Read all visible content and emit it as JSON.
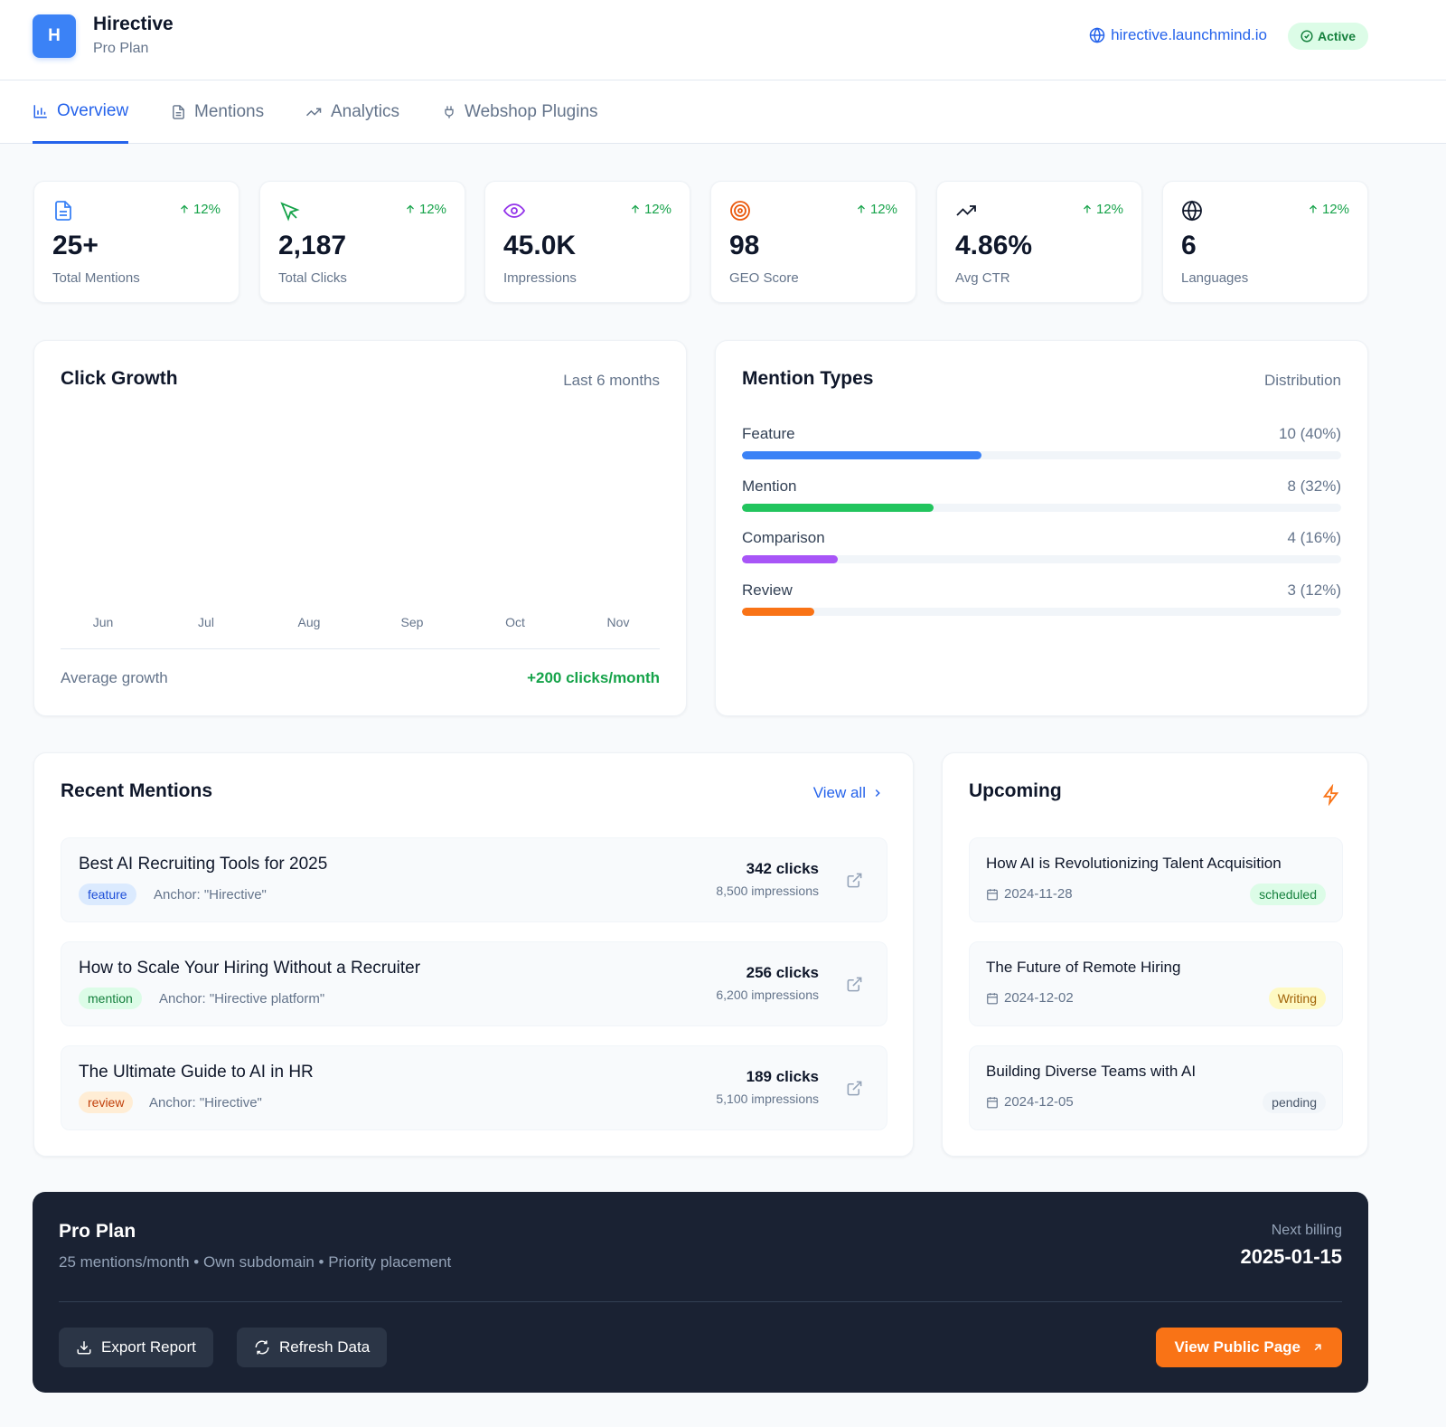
{
  "header": {
    "logo_letter": "H",
    "brand_name": "Hirective",
    "plan": "Pro Plan",
    "domain": "hirective.launchmind.io",
    "status": "Active"
  },
  "tabs": [
    {
      "label": "Overview",
      "icon": "bar-chart-icon",
      "active": true
    },
    {
      "label": "Mentions",
      "icon": "document-icon",
      "active": false
    },
    {
      "label": "Analytics",
      "icon": "trending-up-icon",
      "active": false
    },
    {
      "label": "Webshop Plugins",
      "icon": "plug-icon",
      "active": false
    }
  ],
  "stats": [
    {
      "value": "25+",
      "label": "Total Mentions",
      "trend": "12%",
      "icon": "document-icon",
      "color": "#3b82f6"
    },
    {
      "value": "2,187",
      "label": "Total Clicks",
      "trend": "12%",
      "icon": "cursor-icon",
      "color": "#16a34a"
    },
    {
      "value": "45.0K",
      "label": "Impressions",
      "trend": "12%",
      "icon": "eye-icon",
      "color": "#9333ea"
    },
    {
      "value": "98",
      "label": "GEO Score",
      "trend": "12%",
      "icon": "target-icon",
      "color": "#ea580c"
    },
    {
      "value": "4.86%",
      "label": "Avg CTR",
      "trend": "12%",
      "icon": "trending-up-icon",
      "color": "#0f172a"
    },
    {
      "value": "6",
      "label": "Languages",
      "trend": "12%",
      "icon": "globe-icon",
      "color": "#0f172a"
    }
  ],
  "click_growth": {
    "title": "Click Growth",
    "subtitle": "Last 6 months",
    "months": [
      "Jun",
      "Jul",
      "Aug",
      "Sep",
      "Oct",
      "Nov"
    ],
    "avg_label": "Average growth",
    "avg_value": "+200 clicks/month"
  },
  "mention_types": {
    "title": "Mention Types",
    "subtitle": "Distribution",
    "items": [
      {
        "name": "Feature",
        "count": "10 (40%)",
        "percent": 40,
        "color": "#3b82f6"
      },
      {
        "name": "Mention",
        "count": "8 (32%)",
        "percent": 32,
        "color": "#22c55e"
      },
      {
        "name": "Comparison",
        "count": "4 (16%)",
        "percent": 16,
        "color": "#a855f7"
      },
      {
        "name": "Review",
        "count": "3 (12%)",
        "percent": 12,
        "color": "#f97316"
      }
    ]
  },
  "recent_mentions": {
    "title": "Recent Mentions",
    "view_all": "View all",
    "items": [
      {
        "title": "Best AI Recruiting Tools for 2025",
        "tag": "feature",
        "anchor": "Anchor: \"Hirective\"",
        "clicks": "342 clicks",
        "impressions": "8,500 impressions"
      },
      {
        "title": "How to Scale Your Hiring Without a Recruiter",
        "tag": "mention",
        "anchor": "Anchor: \"Hirective platform\"",
        "clicks": "256 clicks",
        "impressions": "6,200 impressions"
      },
      {
        "title": "The Ultimate Guide to AI in HR",
        "tag": "review",
        "anchor": "Anchor: \"Hirective\"",
        "clicks": "189 clicks",
        "impressions": "5,100 impressions"
      }
    ]
  },
  "upcoming": {
    "title": "Upcoming",
    "items": [
      {
        "title": "How AI is Revolutionizing Talent Acquisition",
        "date": "2024-11-28",
        "status": "scheduled"
      },
      {
        "title": "The Future of Remote Hiring",
        "date": "2024-12-02",
        "status": "Writing"
      },
      {
        "title": "Building Diverse Teams with AI",
        "date": "2024-12-05",
        "status": "pending"
      }
    ]
  },
  "plan_bar": {
    "title": "Pro Plan",
    "features": "25 mentions/month • Own subdomain • Priority placement",
    "billing_label": "Next billing",
    "billing_date": "2025-01-15",
    "export_label": "Export Report",
    "refresh_label": "Refresh Data",
    "public_label": "View Public Page"
  }
}
